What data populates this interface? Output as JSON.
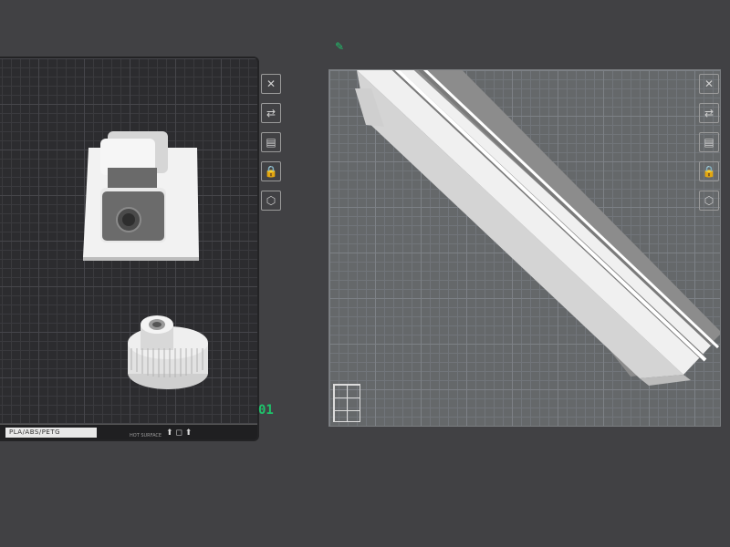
{
  "plates": {
    "left": {
      "filament": "PLA/ABS/PETG",
      "footer_small": "HOT SURFACE",
      "footer_icons": "⬆ ◻ ⬆"
    },
    "right": {}
  },
  "plate_number": "01",
  "toolbar": {
    "buttons": [
      {
        "icon": "close-icon",
        "glyph": "✕"
      },
      {
        "icon": "arrange-icon",
        "glyph": "⇄"
      },
      {
        "icon": "layout-icon",
        "glyph": "▤"
      },
      {
        "icon": "lock-icon",
        "glyph": "🔒"
      },
      {
        "icon": "settings-icon",
        "glyph": "⬡"
      }
    ]
  },
  "colors": {
    "accent": "#1fc16b",
    "background": "#414144",
    "plate_dark": "#2c2c2f",
    "plate_light": "#65686a",
    "model": "#e6e6e6"
  }
}
